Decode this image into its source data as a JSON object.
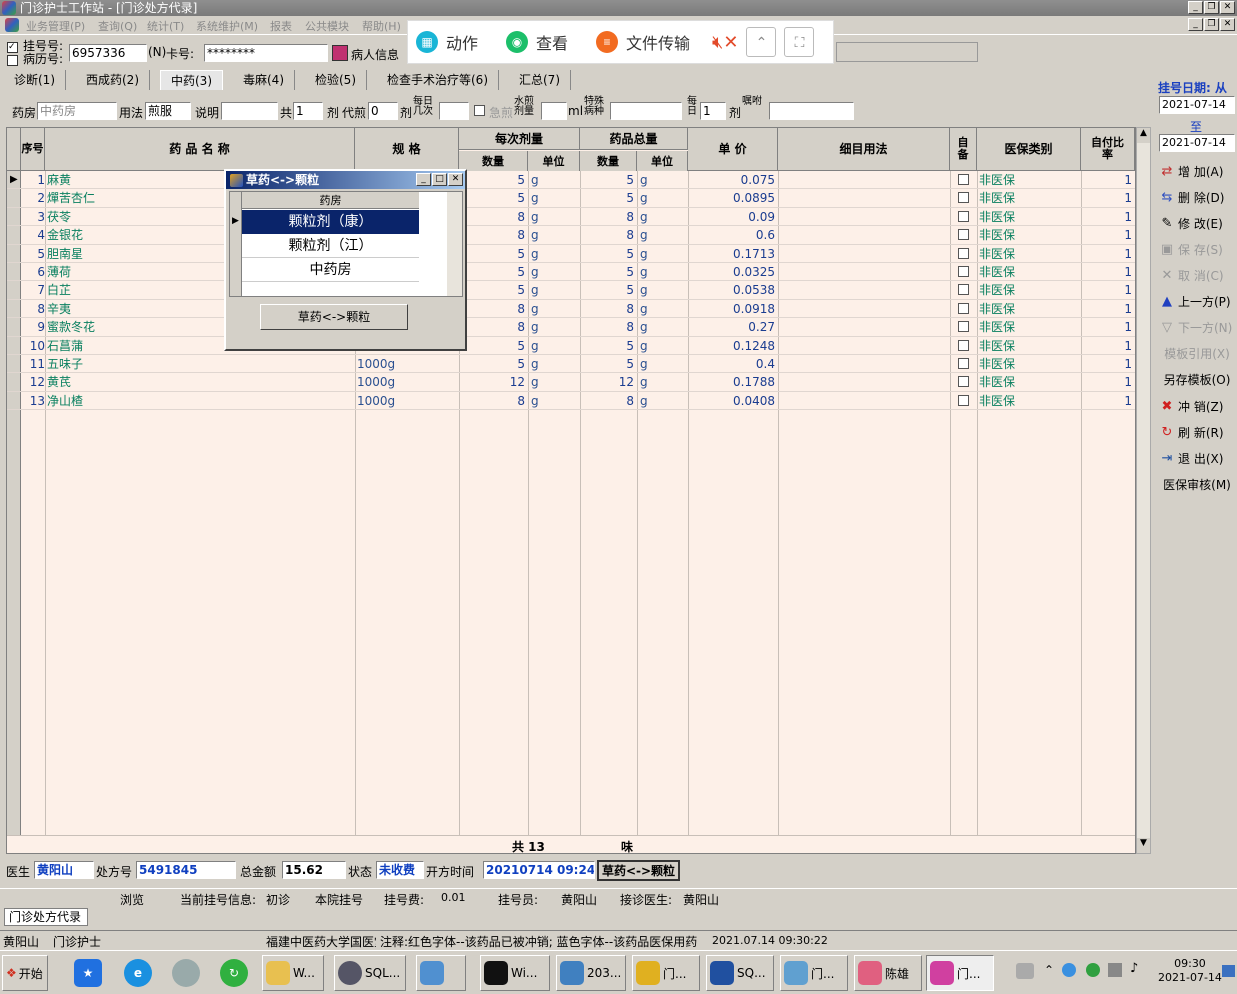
{
  "window": {
    "title": "门诊护士工作站 - [门诊处方代录]"
  },
  "menu": [
    "业务管理(P)",
    "查询(Q)",
    "统计(T)",
    "系统维护(M)",
    "报表",
    "公共模块",
    "帮助(H)"
  ],
  "float_toolbar": {
    "action": "动作",
    "view": "查看",
    "file_transfer": "文件传输"
  },
  "patient": {
    "reg_label": "挂号号:",
    "record_label": "病历号:",
    "reg_value": "6957336",
    "card_prefix": "(N)",
    "card_label": "卡号:",
    "card_value": "********",
    "info_label": "病人信息"
  },
  "tabs": [
    "诊断(1)",
    "西成药(2)",
    "中药(3)",
    "毒麻(4)",
    "检验(5)",
    "检查手术治疗等(6)",
    "汇总(7)"
  ],
  "filters": {
    "pharmacy_label": "药房",
    "pharmacy_value": "中药房",
    "usage_label": "用法",
    "usage_value": "煎服",
    "note_label": "说明",
    "total_label": "共",
    "total_value": "1",
    "dose_label": "剂",
    "decoct_label": "代煎",
    "decoct_value": "0",
    "decoct_unit": "剂",
    "daily_label": "每日几次",
    "urgent_label": "急煎",
    "water_label": "水煎剂量",
    "ml_label": "ml",
    "special_label": "特殊病种",
    "per_label": "每日",
    "per_value": "1",
    "dose2_label": "剂",
    "msg_label": "嘱咐"
  },
  "date_panel": {
    "label": "挂号日期: 从",
    "from": "2021-07-14",
    "to_label": "至",
    "to": "2021-07-14"
  },
  "table": {
    "headers": {
      "seq": "序号",
      "name": "药 品 名 称",
      "spec": "规 格",
      "dose_group": "每次剂量",
      "qty": "数量",
      "unit": "单位",
      "total_group": "药品总量",
      "qty2": "数量",
      "unit2": "单位",
      "price": "单 价",
      "usage": "细目用法",
      "self": "自备",
      "insurance": "医保类别",
      "ratio": "自付比率"
    },
    "rows": [
      {
        "no": "1",
        "name": "麻黄",
        "spec": "",
        "dose": "5",
        "unit": "g",
        "total": "5",
        "unit2": "g",
        "price": "0.075",
        "ins": "非医保",
        "ratio": "1"
      },
      {
        "no": "2",
        "name": "燀苦杏仁",
        "spec": "",
        "dose": "5",
        "unit": "g",
        "total": "5",
        "unit2": "g",
        "price": "0.0895",
        "ins": "非医保",
        "ratio": "1"
      },
      {
        "no": "3",
        "name": "茯苓",
        "spec": "",
        "dose": "8",
        "unit": "g",
        "total": "8",
        "unit2": "g",
        "price": "0.09",
        "ins": "非医保",
        "ratio": "1"
      },
      {
        "no": "4",
        "name": "金银花",
        "spec": "",
        "dose": "8",
        "unit": "g",
        "total": "8",
        "unit2": "g",
        "price": "0.6",
        "ins": "非医保",
        "ratio": "1"
      },
      {
        "no": "5",
        "name": "胆南星",
        "spec": "",
        "dose": "5",
        "unit": "g",
        "total": "5",
        "unit2": "g",
        "price": "0.1713",
        "ins": "非医保",
        "ratio": "1"
      },
      {
        "no": "6",
        "name": "薄荷",
        "spec": "",
        "dose": "5",
        "unit": "g",
        "total": "5",
        "unit2": "g",
        "price": "0.0325",
        "ins": "非医保",
        "ratio": "1"
      },
      {
        "no": "7",
        "name": "白芷",
        "spec": "",
        "dose": "5",
        "unit": "g",
        "total": "5",
        "unit2": "g",
        "price": "0.0538",
        "ins": "非医保",
        "ratio": "1"
      },
      {
        "no": "8",
        "name": "辛夷",
        "spec": "",
        "dose": "8",
        "unit": "g",
        "total": "8",
        "unit2": "g",
        "price": "0.0918",
        "ins": "非医保",
        "ratio": "1"
      },
      {
        "no": "9",
        "name": "蜜款冬花",
        "spec": "",
        "dose": "8",
        "unit": "g",
        "total": "8",
        "unit2": "g",
        "price": "0.27",
        "ins": "非医保",
        "ratio": "1"
      },
      {
        "no": "10",
        "name": "石菖蒲",
        "spec": "",
        "dose": "5",
        "unit": "g",
        "total": "5",
        "unit2": "g",
        "price": "0.1248",
        "ins": "非医保",
        "ratio": "1"
      },
      {
        "no": "11",
        "name": "五味子",
        "spec": "1000g",
        "dose": "5",
        "unit": "g",
        "total": "5",
        "unit2": "g",
        "price": "0.4",
        "ins": "非医保",
        "ratio": "1"
      },
      {
        "no": "12",
        "name": "黄芪",
        "spec": "1000g",
        "dose": "12",
        "unit": "g",
        "total": "12",
        "unit2": "g",
        "price": "0.1788",
        "ins": "非医保",
        "ratio": "1"
      },
      {
        "no": "13",
        "name": "净山楂",
        "spec": "1000g",
        "dose": "8",
        "unit": "g",
        "total": "8",
        "unit2": "g",
        "price": "0.0408",
        "ins": "非医保",
        "ratio": "1"
      }
    ],
    "footer_total": "共 13",
    "footer_unit": "味"
  },
  "popup": {
    "title": "草药<->颗粒",
    "col_header": "药房",
    "options": [
      "颗粒剂（康）",
      "颗粒剂（江）",
      "中药房"
    ],
    "button": "草药<->颗粒"
  },
  "side_buttons": [
    "增 加(A)",
    "删 除(D)",
    "修 改(E)",
    "保 存(S)",
    "取 消(C)",
    "上一方(P)",
    "下一方(N)",
    "模板引用(X)",
    "另存模板(O)",
    "冲 销(Z)",
    "刷 新(R)",
    "退 出(X)",
    "医保审核(M)"
  ],
  "bottom": {
    "doctor_label": "医生",
    "doctor": "黄阳山",
    "rx_label": "处方号",
    "rx": "5491845",
    "amount_label": "总金额",
    "amount": "15.62",
    "state_label": "状态",
    "state": "未收费",
    "time_label": "开方时间",
    "time": "20210714 09:24",
    "herb_btn": "草药<->颗粒"
  },
  "status1": {
    "browse": "浏览",
    "reg_info_label": "当前挂号信息:",
    "visit": "初诊",
    "hospital": "本院挂号",
    "fee_label": "挂号费:",
    "fee": "0.01",
    "clerk_label": "挂号员:",
    "clerk": "黄阳山",
    "doctor_label": "接诊医生:",
    "doctor": "黄阳山"
  },
  "doc_tab": "门诊处方代录",
  "status2": {
    "user": "黄阳山",
    "role": "门诊护士",
    "hospital": "福建中医药大学国医堂",
    "note": "注释:红色字体--该药品已被冲销; 蓝色字体--该药品医保用药",
    "datetime": "2021.07.14 09:30:22"
  },
  "taskbar": {
    "start": "开始",
    "items": [
      "W...",
      "SQL...",
      "Wi...",
      "203...",
      "门...",
      "SQ...",
      "门...",
      "陈雄",
      "门..."
    ],
    "time": "09:30",
    "date": "2021-07-14"
  }
}
